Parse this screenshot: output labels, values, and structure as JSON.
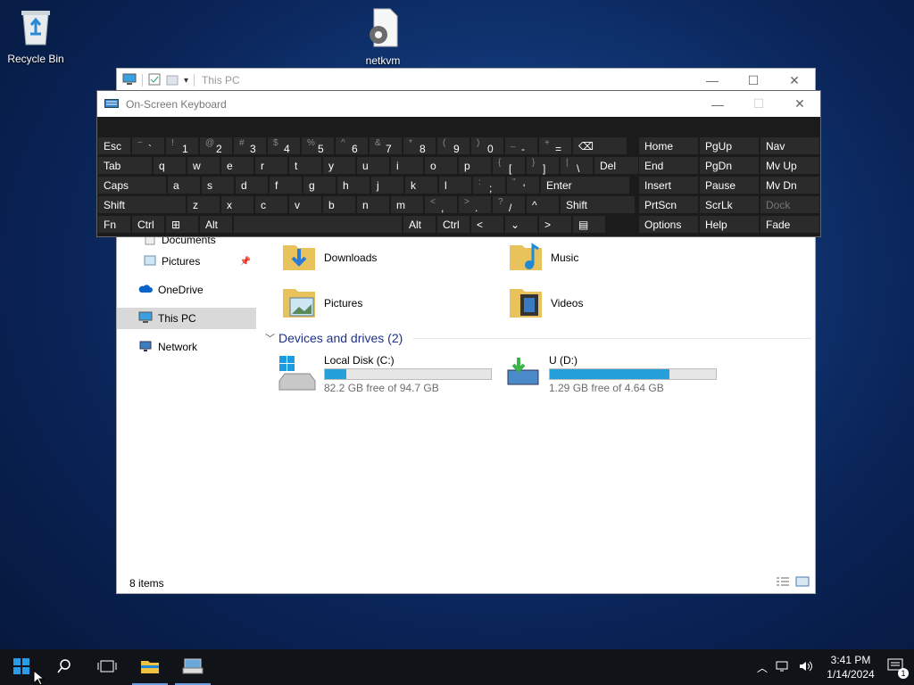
{
  "desktop": {
    "icons": [
      {
        "label": "Recycle Bin"
      },
      {
        "label": "netkvm"
      }
    ]
  },
  "explorer": {
    "title": "This PC",
    "nav": {
      "items": [
        {
          "label": "Documents"
        },
        {
          "label": "Pictures"
        },
        {
          "label": "OneDrive"
        },
        {
          "label": "This PC"
        },
        {
          "label": "Network"
        }
      ]
    },
    "folders": [
      {
        "label": "Downloads"
      },
      {
        "label": "Music"
      },
      {
        "label": "Pictures"
      },
      {
        "label": "Videos"
      }
    ],
    "devices_header": "Devices and drives (2)",
    "drives": [
      {
        "name": "Local Disk (C:)",
        "free_text": "82.2 GB free of 94.7 GB",
        "used_fraction": 0.13
      },
      {
        "name": "U (D:)",
        "free_text": "1.29 GB free of 4.64 GB",
        "used_fraction": 0.72
      }
    ],
    "status": "8 items"
  },
  "osk": {
    "title": "On-Screen Keyboard",
    "rows": [
      [
        {
          "main": "Esc"
        },
        {
          "shift": "~",
          "main": "`"
        },
        {
          "shift": "!",
          "main": "1"
        },
        {
          "shift": "@",
          "main": "2"
        },
        {
          "shift": "#",
          "main": "3"
        },
        {
          "shift": "$",
          "main": "4"
        },
        {
          "shift": "%",
          "main": "5"
        },
        {
          "shift": "^",
          "main": "6"
        },
        {
          "shift": "&",
          "main": "7"
        },
        {
          "shift": "*",
          "main": "8"
        },
        {
          "shift": "(",
          "main": "9"
        },
        {
          "shift": ")",
          "main": "0"
        },
        {
          "shift": "_",
          "main": "-"
        },
        {
          "shift": "+",
          "main": "="
        },
        {
          "main": "⌫"
        }
      ],
      [
        {
          "main": "Tab"
        },
        {
          "main": "q"
        },
        {
          "main": "w"
        },
        {
          "main": "e"
        },
        {
          "main": "r"
        },
        {
          "main": "t"
        },
        {
          "main": "y"
        },
        {
          "main": "u"
        },
        {
          "main": "i"
        },
        {
          "main": "o"
        },
        {
          "main": "p"
        },
        {
          "shift": "{",
          "main": "["
        },
        {
          "shift": "}",
          "main": "]"
        },
        {
          "shift": "|",
          "main": "\\"
        },
        {
          "main": "Del"
        }
      ],
      [
        {
          "main": "Caps"
        },
        {
          "main": "a"
        },
        {
          "main": "s"
        },
        {
          "main": "d"
        },
        {
          "main": "f"
        },
        {
          "main": "g"
        },
        {
          "main": "h"
        },
        {
          "main": "j"
        },
        {
          "main": "k"
        },
        {
          "main": "l"
        },
        {
          "shift": ":",
          "main": ";"
        },
        {
          "shift": "\"",
          "main": "'"
        },
        {
          "main": "Enter"
        }
      ],
      [
        {
          "main": "Shift"
        },
        {
          "main": "z"
        },
        {
          "main": "x"
        },
        {
          "main": "c"
        },
        {
          "main": "v"
        },
        {
          "main": "b"
        },
        {
          "main": "n"
        },
        {
          "main": "m"
        },
        {
          "shift": "<",
          "main": ","
        },
        {
          "shift": ">",
          "main": "."
        },
        {
          "shift": "?",
          "main": "/"
        },
        {
          "main": "^"
        },
        {
          "main": "Shift"
        }
      ],
      [
        {
          "main": "Fn"
        },
        {
          "main": "Ctrl"
        },
        {
          "main": "⊞"
        },
        {
          "main": "Alt"
        },
        {
          "main": ""
        },
        {
          "main": "Alt"
        },
        {
          "main": "Ctrl"
        },
        {
          "main": "<"
        },
        {
          "main": "⌄"
        },
        {
          "main": ">"
        },
        {
          "main": "▤"
        }
      ]
    ],
    "right_keys": [
      [
        "Home",
        "PgUp",
        "Nav"
      ],
      [
        "End",
        "PgDn",
        "Mv Up"
      ],
      [
        "Insert",
        "Pause",
        "Mv Dn"
      ],
      [
        "PrtScn",
        "ScrLk",
        "Dock"
      ],
      [
        "Options",
        "Help",
        "Fade"
      ]
    ]
  },
  "taskbar": {
    "time": "3:41 PM",
    "date": "1/14/2024",
    "notification_count": "1"
  }
}
